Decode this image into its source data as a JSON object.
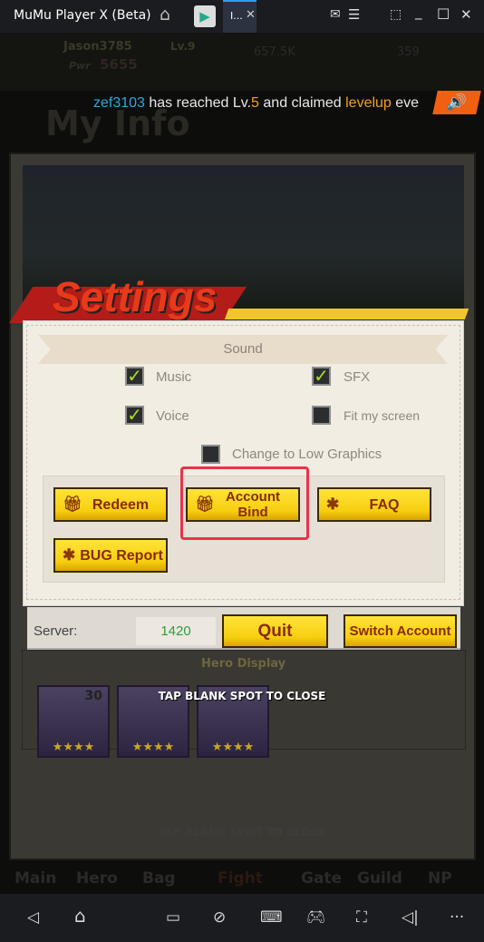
{
  "titlebar": {
    "title": "MuMu Player X  (Beta)",
    "tab_label": "I...",
    "icons": [
      "home-icon",
      "play-store-icon",
      "close-icon",
      "mail-icon",
      "menu-icon",
      "screenshot-icon",
      "minimize-icon",
      "maximize-icon",
      "close-icon"
    ]
  },
  "game_bg": {
    "player": "Jason3785",
    "level": "Lv.9",
    "power_label": "Pwr",
    "power": "5655",
    "gold": "657.5K",
    "gems": "359",
    "page_title": "My Info",
    "hero_display": "Hero Display"
  },
  "announcement": {
    "name": "zef3103",
    "text1": " has reached Lv.",
    "level": "5",
    "text2": " and claimed ",
    "event": "levelup",
    "text3": " eve"
  },
  "settings": {
    "title": "Settings",
    "section": "Sound",
    "checkboxes": [
      {
        "label": "Music",
        "checked": true
      },
      {
        "label": "SFX",
        "checked": true
      },
      {
        "label": "Voice",
        "checked": true
      },
      {
        "label": "Fit my screen",
        "checked": false
      },
      {
        "label": "Change to Low Graphics",
        "checked": false
      }
    ],
    "buttons": {
      "redeem": "Redeem",
      "account_bind_1": "Account",
      "account_bind_2": "Bind",
      "faq": "FAQ",
      "bug_report": "BUG Report"
    },
    "server_label": "Server:",
    "server_value": "1420",
    "quit": "Quit",
    "switch_account": "Switch Account"
  },
  "heroes": [
    {
      "level": "30",
      "stars": "★★★★"
    },
    {
      "level": "",
      "stars": "★★★★"
    },
    {
      "level": "",
      "stars": "★★★★"
    }
  ],
  "tap_close": "TAP BLANK SPOT TO CLOSE",
  "bottom_nav": [
    "Main",
    "Hero",
    "Bag",
    "Fight",
    "Gate",
    "Guild",
    "NP"
  ],
  "colors": {
    "accent_yellow": "#f7cf10",
    "highlight": "#e8344a",
    "announce_name": "#2aa8e0",
    "announce_event": "#f0a020"
  }
}
